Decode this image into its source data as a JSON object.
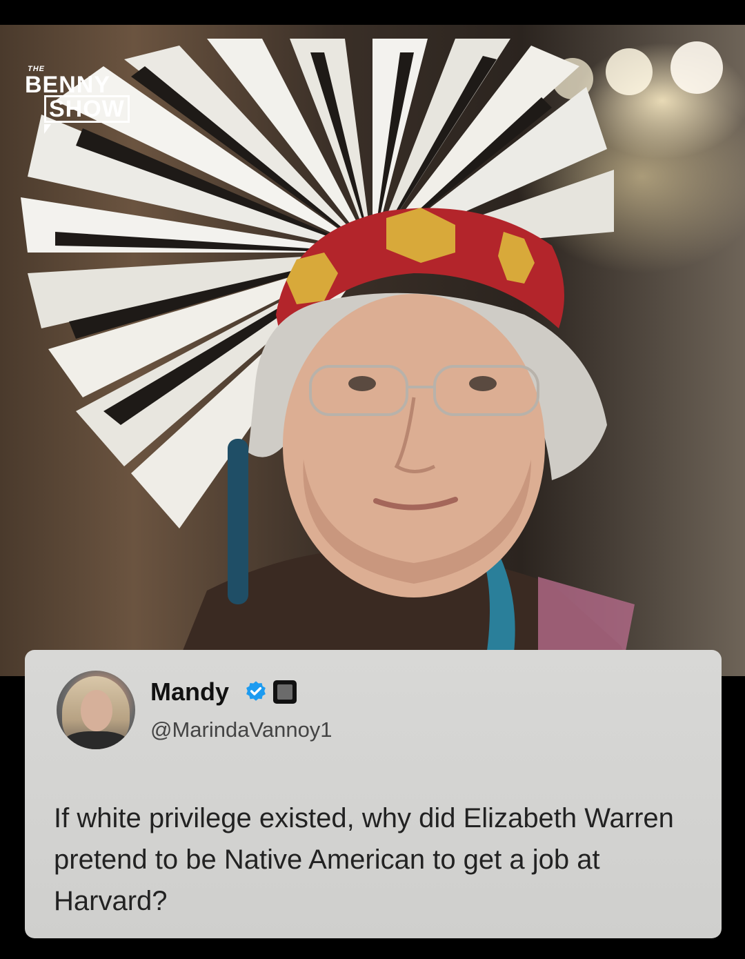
{
  "brand": {
    "small": "THE",
    "line1": "BENNY",
    "line2": "SHOW"
  },
  "photo": {
    "subject": "woman-in-feather-headdress"
  },
  "tweet": {
    "display_name": "Mandy",
    "handle": "@MarindaVannoy1",
    "verified": true,
    "text": "If white privilege existed, why did Elizabeth Warren pretend to be Native American to get a job at Harvard?"
  },
  "colors": {
    "background": "#000000",
    "card": "#d4d4d2",
    "verified_badge": "#1d9bf0",
    "text": "#222222"
  },
  "icons": {
    "verified": "verified-check-icon",
    "affiliate": "affiliate-badge-icon"
  }
}
